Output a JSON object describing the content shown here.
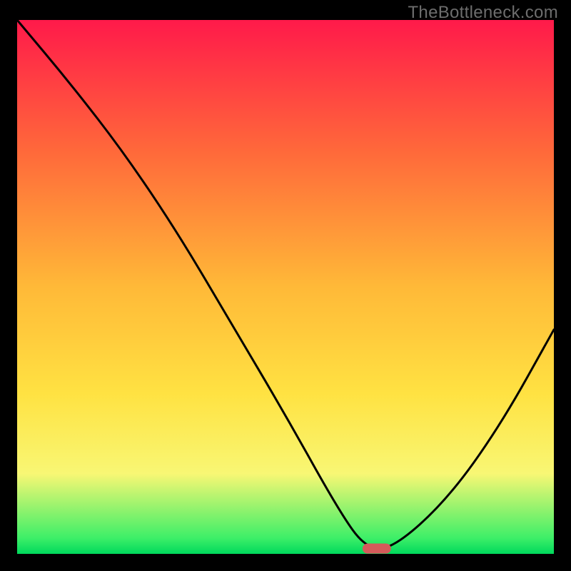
{
  "watermark": "TheBottleneck.com",
  "chart_data": {
    "type": "line",
    "title": "",
    "xlabel": "",
    "ylabel": "",
    "xlim": [
      0,
      100
    ],
    "ylim": [
      0,
      100
    ],
    "gradient_bg": {
      "description": "Vertical gradient red → orange → yellow → pale-yellow → green",
      "stops": [
        {
          "pct": 0,
          "color": "#ff1a4a"
        },
        {
          "pct": 25,
          "color": "#ff6a3a"
        },
        {
          "pct": 50,
          "color": "#ffb938"
        },
        {
          "pct": 70,
          "color": "#ffe242"
        },
        {
          "pct": 85,
          "color": "#f8f774"
        },
        {
          "pct": 97,
          "color": "#3eef68"
        },
        {
          "pct": 100,
          "color": "#00d95c"
        }
      ]
    },
    "series": [
      {
        "name": "bottleneck-curve",
        "x": [
          0,
          10,
          20,
          30,
          40,
          50,
          60,
          65,
          70,
          80,
          90,
          100
        ],
        "y": [
          100,
          88,
          75,
          60,
          43,
          26,
          8,
          1,
          1,
          10,
          24,
          42
        ]
      }
    ],
    "marker": {
      "name": "optimal-point",
      "x": 67,
      "y": 1,
      "color": "#d45a5a",
      "shape": "rounded-rect"
    }
  }
}
